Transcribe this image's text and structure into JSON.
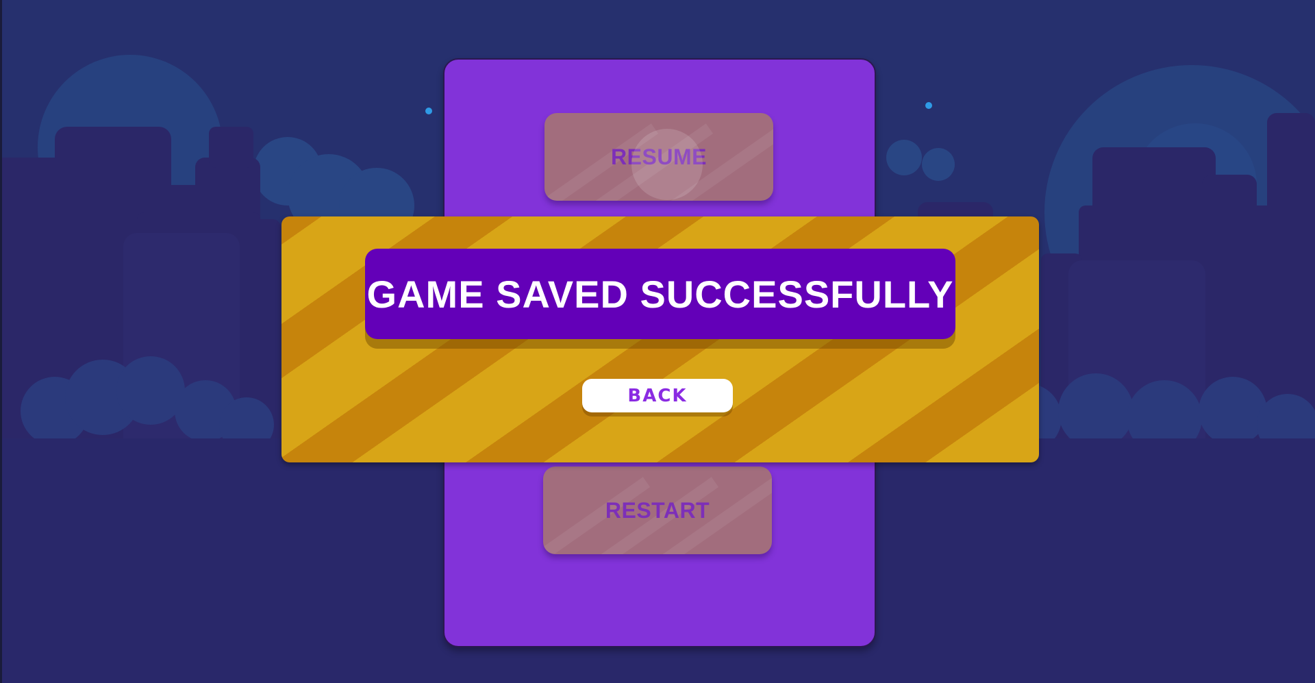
{
  "pause_menu": {
    "resume_label": "RESUME",
    "restart_label": "RESTART"
  },
  "save_dialog": {
    "message": "GAME SAVED SUCCESSFULLY",
    "back_label": "BACK"
  },
  "colors": {
    "sky": "#272a6a",
    "panel": "#8233d9",
    "banner_light": "#d8a517",
    "banner_dark": "#c6840c",
    "title_box": "#6300b8",
    "button_muted": "#a26d7d",
    "accent_text": "#8a2be2"
  },
  "icons": [
    "star-icon"
  ]
}
